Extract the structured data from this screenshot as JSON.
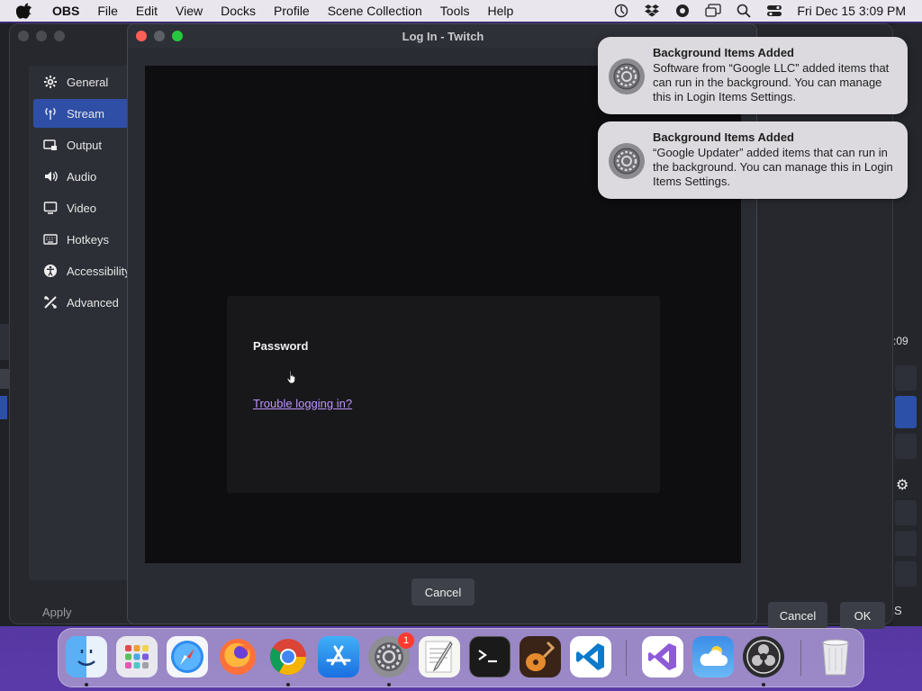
{
  "menubar": {
    "app_name": "OBS",
    "items": [
      "File",
      "Edit",
      "View",
      "Docks",
      "Profile",
      "Scene Collection",
      "Tools",
      "Help"
    ],
    "tray_icons": [
      "activity-monitor-icon",
      "dropbox-icon",
      "record-icon",
      "screen-mirror-icon",
      "spotlight-search-icon",
      "control-center-icon"
    ],
    "clock": "Fri Dec 15  3:09 PM"
  },
  "settings": {
    "nav": [
      {
        "label": "General",
        "icon": "gear-icon"
      },
      {
        "label": "Stream",
        "icon": "antenna-icon",
        "active": true
      },
      {
        "label": "Output",
        "icon": "output-icon"
      },
      {
        "label": "Audio",
        "icon": "speaker-icon"
      },
      {
        "label": "Video",
        "icon": "monitor-icon"
      },
      {
        "label": "Hotkeys",
        "icon": "keyboard-icon"
      },
      {
        "label": "Accessibility",
        "icon": "accessibility-icon"
      },
      {
        "label": "Advanced",
        "icon": "wrench-icon"
      }
    ],
    "apply_label": "Apply",
    "cancel_label": "Cancel",
    "ok_label": "OK"
  },
  "login": {
    "window_title": "Log In - Twitch",
    "password_label": "Password",
    "trouble_link": "Trouble logging in?",
    "cancel_label": "Cancel"
  },
  "background_window": {
    "time_fragment": ":09",
    "s_fragment": "S"
  },
  "notifications": [
    {
      "title": "Background Items Added",
      "body": "Software from “Google LLC” added items that can run in the background. You can manage this in Login Items Settings."
    },
    {
      "title": "Background Items Added",
      "body": "“Google Updater” added items that can run in the background. You can manage this in Login Items Settings."
    }
  ],
  "dock": {
    "apps": [
      {
        "name": "finder-icon",
        "running": true
      },
      {
        "name": "launchpad-icon",
        "running": false
      },
      {
        "name": "safari-icon",
        "running": false
      },
      {
        "name": "firefox-icon",
        "running": false
      },
      {
        "name": "chrome-icon",
        "running": true
      },
      {
        "name": "app-store-icon",
        "running": false
      },
      {
        "name": "system-settings-icon",
        "running": true,
        "badge": "1"
      },
      {
        "name": "textedit-icon",
        "running": false
      },
      {
        "name": "terminal-icon",
        "running": false
      },
      {
        "name": "garageband-icon",
        "running": false
      },
      {
        "name": "vscode-icon",
        "running": false
      },
      {
        "name": "visual-studio-icon",
        "running": false
      },
      {
        "name": "weather-icon",
        "running": false
      },
      {
        "name": "obs-icon",
        "running": true
      },
      {
        "name": "trash-icon",
        "running": false
      }
    ]
  },
  "colors": {
    "accent_blue": "#2f4fa6",
    "link_purple": "#bf94ff",
    "close_red": "#fe5f57",
    "zoom_green": "#28c840",
    "badge_red": "#ff3b30"
  }
}
